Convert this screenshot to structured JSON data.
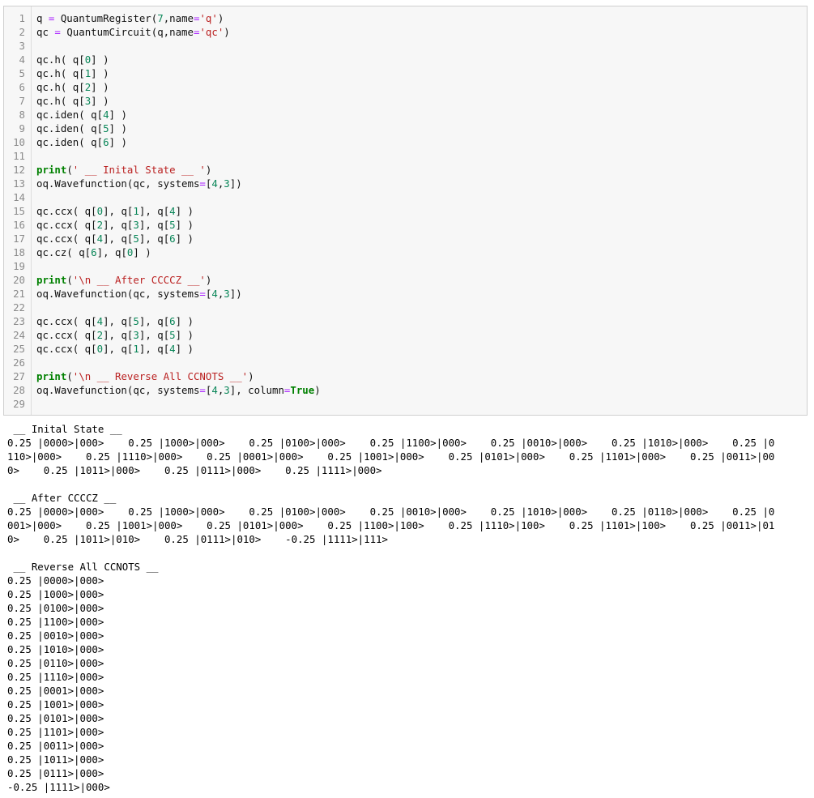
{
  "code": [
    {
      "n": "1",
      "tokens": [
        [
          "t",
          "q "
        ],
        [
          "o",
          "="
        ],
        [
          "t",
          " QuantumRegister("
        ],
        [
          "m",
          "7"
        ],
        [
          "t",
          ",name"
        ],
        [
          "o",
          "="
        ],
        [
          "s",
          "'q'"
        ],
        [
          "t",
          ")"
        ]
      ]
    },
    {
      "n": "2",
      "tokens": [
        [
          "t",
          "qc "
        ],
        [
          "o",
          "="
        ],
        [
          "t",
          " QuantumCircuit(q,name"
        ],
        [
          "o",
          "="
        ],
        [
          "s",
          "'qc'"
        ],
        [
          "t",
          ")"
        ]
      ]
    },
    {
      "n": "3",
      "tokens": []
    },
    {
      "n": "4",
      "tokens": [
        [
          "t",
          "qc.h( q["
        ],
        [
          "m",
          "0"
        ],
        [
          "t",
          "] )"
        ]
      ]
    },
    {
      "n": "5",
      "tokens": [
        [
          "t",
          "qc.h( q["
        ],
        [
          "m",
          "1"
        ],
        [
          "t",
          "] )"
        ]
      ]
    },
    {
      "n": "6",
      "tokens": [
        [
          "t",
          "qc.h( q["
        ],
        [
          "m",
          "2"
        ],
        [
          "t",
          "] )"
        ]
      ]
    },
    {
      "n": "7",
      "tokens": [
        [
          "t",
          "qc.h( q["
        ],
        [
          "m",
          "3"
        ],
        [
          "t",
          "] )"
        ]
      ]
    },
    {
      "n": "8",
      "tokens": [
        [
          "t",
          "qc.iden( q["
        ],
        [
          "m",
          "4"
        ],
        [
          "t",
          "] )"
        ]
      ]
    },
    {
      "n": "9",
      "tokens": [
        [
          "t",
          "qc.iden( q["
        ],
        [
          "m",
          "5"
        ],
        [
          "t",
          "] )"
        ]
      ]
    },
    {
      "n": "10",
      "tokens": [
        [
          "t",
          "qc.iden( q["
        ],
        [
          "m",
          "6"
        ],
        [
          "t",
          "] )"
        ]
      ]
    },
    {
      "n": "11",
      "tokens": []
    },
    {
      "n": "12",
      "tokens": [
        [
          "k",
          "print"
        ],
        [
          "t",
          "("
        ],
        [
          "s",
          "' __ Inital State __ '"
        ],
        [
          "t",
          ")"
        ]
      ]
    },
    {
      "n": "13",
      "tokens": [
        [
          "t",
          "oq.Wavefunction(qc, systems"
        ],
        [
          "o",
          "="
        ],
        [
          "t",
          "["
        ],
        [
          "m",
          "4"
        ],
        [
          "t",
          ","
        ],
        [
          "m",
          "3"
        ],
        [
          "t",
          "])"
        ]
      ]
    },
    {
      "n": "14",
      "tokens": []
    },
    {
      "n": "15",
      "tokens": [
        [
          "t",
          "qc.ccx( q["
        ],
        [
          "m",
          "0"
        ],
        [
          "t",
          "], q["
        ],
        [
          "m",
          "1"
        ],
        [
          "t",
          "], q["
        ],
        [
          "m",
          "4"
        ],
        [
          "t",
          "] )"
        ]
      ]
    },
    {
      "n": "16",
      "tokens": [
        [
          "t",
          "qc.ccx( q["
        ],
        [
          "m",
          "2"
        ],
        [
          "t",
          "], q["
        ],
        [
          "m",
          "3"
        ],
        [
          "t",
          "], q["
        ],
        [
          "m",
          "5"
        ],
        [
          "t",
          "] )"
        ]
      ]
    },
    {
      "n": "17",
      "tokens": [
        [
          "t",
          "qc.ccx( q["
        ],
        [
          "m",
          "4"
        ],
        [
          "t",
          "], q["
        ],
        [
          "m",
          "5"
        ],
        [
          "t",
          "], q["
        ],
        [
          "m",
          "6"
        ],
        [
          "t",
          "] )"
        ]
      ]
    },
    {
      "n": "18",
      "tokens": [
        [
          "t",
          "qc.cz( q["
        ],
        [
          "m",
          "6"
        ],
        [
          "t",
          "], q["
        ],
        [
          "m",
          "0"
        ],
        [
          "t",
          "] )"
        ]
      ]
    },
    {
      "n": "19",
      "tokens": []
    },
    {
      "n": "20",
      "tokens": [
        [
          "k",
          "print"
        ],
        [
          "t",
          "("
        ],
        [
          "s",
          "'\\n __ After CCCCZ __'"
        ],
        [
          "t",
          ")"
        ]
      ]
    },
    {
      "n": "21",
      "tokens": [
        [
          "t",
          "oq.Wavefunction(qc, systems"
        ],
        [
          "o",
          "="
        ],
        [
          "t",
          "["
        ],
        [
          "m",
          "4"
        ],
        [
          "t",
          ","
        ],
        [
          "m",
          "3"
        ],
        [
          "t",
          "])"
        ]
      ]
    },
    {
      "n": "22",
      "tokens": []
    },
    {
      "n": "23",
      "tokens": [
        [
          "t",
          "qc.ccx( q["
        ],
        [
          "m",
          "4"
        ],
        [
          "t",
          "], q["
        ],
        [
          "m",
          "5"
        ],
        [
          "t",
          "], q["
        ],
        [
          "m",
          "6"
        ],
        [
          "t",
          "] )"
        ]
      ]
    },
    {
      "n": "24",
      "tokens": [
        [
          "t",
          "qc.ccx( q["
        ],
        [
          "m",
          "2"
        ],
        [
          "t",
          "], q["
        ],
        [
          "m",
          "3"
        ],
        [
          "t",
          "], q["
        ],
        [
          "m",
          "5"
        ],
        [
          "t",
          "] )"
        ]
      ]
    },
    {
      "n": "25",
      "tokens": [
        [
          "t",
          "qc.ccx( q["
        ],
        [
          "m",
          "0"
        ],
        [
          "t",
          "], q["
        ],
        [
          "m",
          "1"
        ],
        [
          "t",
          "], q["
        ],
        [
          "m",
          "4"
        ],
        [
          "t",
          "] )"
        ]
      ]
    },
    {
      "n": "26",
      "tokens": []
    },
    {
      "n": "27",
      "tokens": [
        [
          "k",
          "print"
        ],
        [
          "t",
          "("
        ],
        [
          "s",
          "'\\n __ Reverse All CCNOTS __'"
        ],
        [
          "t",
          ")"
        ]
      ]
    },
    {
      "n": "28",
      "tokens": [
        [
          "t",
          "oq.Wavefunction(qc, systems"
        ],
        [
          "o",
          "="
        ],
        [
          "t",
          "["
        ],
        [
          "m",
          "4"
        ],
        [
          "t",
          ","
        ],
        [
          "m",
          "3"
        ],
        [
          "t",
          "], column"
        ],
        [
          "o",
          "="
        ],
        [
          "k",
          "True"
        ],
        [
          "t",
          ")"
        ]
      ]
    },
    {
      "n": "29",
      "tokens": []
    }
  ],
  "output": [
    " __ Inital State __",
    "0.25 |0000>|000>    0.25 |1000>|000>    0.25 |0100>|000>    0.25 |1100>|000>    0.25 |0010>|000>    0.25 |1010>|000>    0.25 |0",
    "110>|000>    0.25 |1110>|000>    0.25 |0001>|000>    0.25 |1001>|000>    0.25 |0101>|000>    0.25 |1101>|000>    0.25 |0011>|00",
    "0>    0.25 |1011>|000>    0.25 |0111>|000>    0.25 |1111>|000>",
    "",
    " __ After CCCCZ __",
    "0.25 |0000>|000>    0.25 |1000>|000>    0.25 |0100>|000>    0.25 |0010>|000>    0.25 |1010>|000>    0.25 |0110>|000>    0.25 |0",
    "001>|000>    0.25 |1001>|000>    0.25 |0101>|000>    0.25 |1100>|100>    0.25 |1110>|100>    0.25 |1101>|100>    0.25 |0011>|01",
    "0>    0.25 |1011>|010>    0.25 |0111>|010>    -0.25 |1111>|111>",
    "",
    " __ Reverse All CCNOTS __",
    "0.25 |0000>|000>",
    "0.25 |1000>|000>",
    "0.25 |0100>|000>",
    "0.25 |1100>|000>",
    "0.25 |0010>|000>",
    "0.25 |1010>|000>",
    "0.25 |0110>|000>",
    "0.25 |1110>|000>",
    "0.25 |0001>|000>",
    "0.25 |1001>|000>",
    "0.25 |0101>|000>",
    "0.25 |1101>|000>",
    "0.25 |0011>|000>",
    "0.25 |1011>|000>",
    "0.25 |0111>|000>",
    "-0.25 |1111>|000>"
  ]
}
